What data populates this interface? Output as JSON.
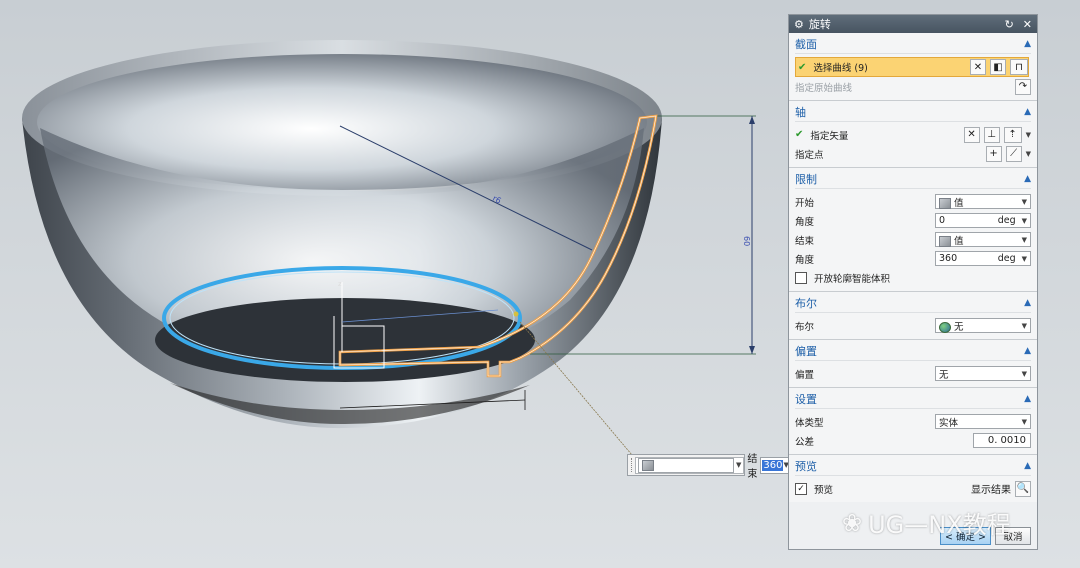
{
  "dialog": {
    "title": "旋转",
    "section": {
      "title": "截面",
      "select_curve": "选择曲线 (9)",
      "specify_origin_curve": "指定原始曲线"
    },
    "axis": {
      "title": "轴",
      "specify_vector": "指定矢量",
      "specify_point": "指定点"
    },
    "limits": {
      "title": "限制",
      "start_label": "开始",
      "start_mode": "值",
      "start_angle_label": "角度",
      "start_angle_value": "0",
      "start_angle_unit": "deg",
      "end_label": "结束",
      "end_mode": "值",
      "end_angle_label": "角度",
      "end_angle_value": "360",
      "end_angle_unit": "deg",
      "open_profile_label": "开放轮廓智能体积"
    },
    "boolean": {
      "title": "布尔",
      "label": "布尔",
      "value": "无"
    },
    "offset": {
      "title": "偏置",
      "label": "偏置",
      "value": "无"
    },
    "settings": {
      "title": "设置",
      "body_type_label": "体类型",
      "body_type_value": "实体",
      "tolerance_label": "公差",
      "tolerance_value": "0. 0010"
    },
    "preview": {
      "title": "预览",
      "preview_label": "预览",
      "show_result_label": "显示结果"
    },
    "buttons": {
      "ok": "< 确定 >",
      "cancel": "取消"
    }
  },
  "float_editor": {
    "label": "结束",
    "value": "360"
  },
  "watermark": {
    "text": "UG—NX教程"
  },
  "colors": {
    "accent_blue": "#1d5fa8",
    "selection_highlight": "#fbd373",
    "profile_orange": "#f0a24a",
    "sketch_circle": "#3aa8e8"
  }
}
